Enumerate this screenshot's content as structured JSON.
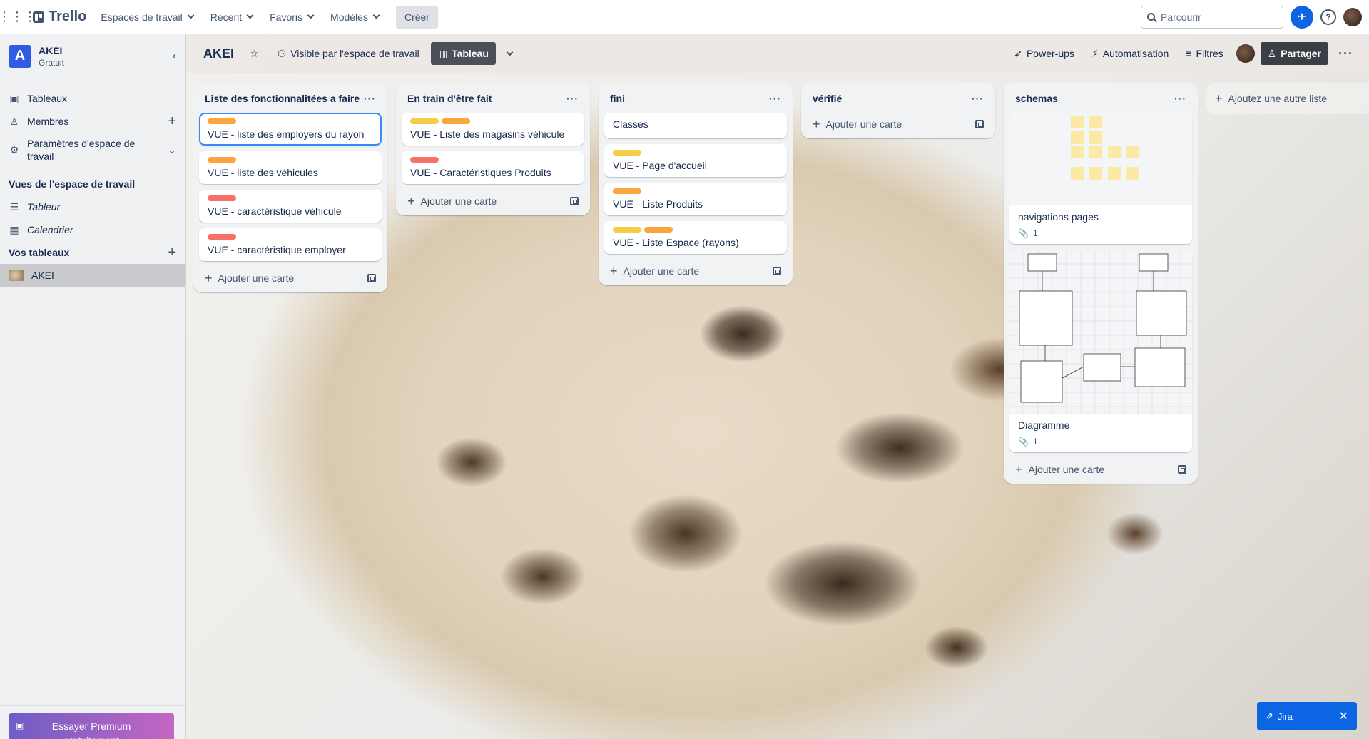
{
  "topnav": {
    "brand": "Trello",
    "menus": [
      "Espaces de travail",
      "Récent",
      "Favoris",
      "Modèles"
    ],
    "create_label": "Créer",
    "search_placeholder": "Parcourir"
  },
  "sidebar": {
    "workspace_initial": "A",
    "workspace_name": "AKEI",
    "workspace_plan": "Gratuit",
    "items": [
      "Tableaux",
      "Membres",
      "Paramètres d'espace de travail"
    ],
    "views_title": "Vues de l'espace de travail",
    "views": [
      "Tableur",
      "Calendrier"
    ],
    "boards_title": "Vos tableaux",
    "boards": [
      "AKEI"
    ],
    "premium_label": "Essayer Premium gratuitement"
  },
  "board": {
    "title": "AKEI",
    "visibility": "Visible par l'espace de travail",
    "view_label": "Tableau",
    "powerups": "Power-ups",
    "automation": "Automatisation",
    "filters": "Filtres",
    "share": "Partager",
    "add_card": "Ajouter une carte",
    "add_list": "Ajoutez une autre liste"
  },
  "colors": {
    "orange": "#faa53d",
    "red": "#f87168",
    "yellow": "#f5cd47",
    "accent": "#0c66e4"
  },
  "lists": [
    {
      "title": "Liste des fonctionnalitées a faire",
      "cards": [
        {
          "title": "VUE - liste des employers du rayon",
          "labels": [
            "orange"
          ]
        },
        {
          "title": "VUE - liste des véhicules",
          "labels": [
            "orange"
          ]
        },
        {
          "title": "VUE - caractéristique véhicule",
          "labels": [
            "red"
          ]
        },
        {
          "title": "VUE - caractéristique employer",
          "labels": [
            "red"
          ]
        }
      ]
    },
    {
      "title": "En train d'être fait",
      "cards": [
        {
          "title": "VUE - Liste des magasins véhicule",
          "labels": [
            "yellow",
            "orange"
          ]
        },
        {
          "title": "VUE - Caractéristiques Produits",
          "labels": [
            "red"
          ]
        }
      ]
    },
    {
      "title": "fini",
      "cards": [
        {
          "title": "Classes",
          "labels": []
        },
        {
          "title": "VUE - Page d'accueil",
          "labels": [
            "yellow"
          ]
        },
        {
          "title": "VUE - Liste Produits",
          "labels": [
            "orange"
          ]
        },
        {
          "title": "VUE - Liste Espace (rayons)",
          "labels": [
            "yellow",
            "orange"
          ]
        }
      ]
    },
    {
      "title": "vérifié",
      "cards": []
    },
    {
      "title": "schemas",
      "cards": [
        {
          "title": "navigations pages",
          "attachments": "1",
          "cover": "sticky-notes"
        },
        {
          "title": "Diagramme",
          "attachments": "1",
          "cover": "uml-diagram"
        }
      ]
    }
  ],
  "jira": {
    "label": "Jira"
  }
}
